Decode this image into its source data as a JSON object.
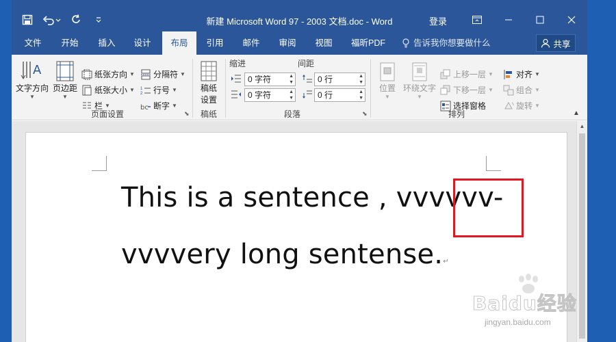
{
  "window": {
    "title": "新建 Microsoft Word 97 - 2003 文档.doc  -  Word",
    "login": "登录"
  },
  "tabs": [
    {
      "label": "文件"
    },
    {
      "label": "开始"
    },
    {
      "label": "插入"
    },
    {
      "label": "设计"
    },
    {
      "label": "布局",
      "active": true
    },
    {
      "label": "引用"
    },
    {
      "label": "邮件"
    },
    {
      "label": "审阅"
    },
    {
      "label": "视图"
    },
    {
      "label": "福昕PDF"
    }
  ],
  "tell_me": "告诉我你想要做什么",
  "share": "共享",
  "ribbon": {
    "page_setup": {
      "text_direction": "文字方向",
      "margins": "页边距",
      "orientation": "纸张方向",
      "size": "纸张大小",
      "columns": "栏",
      "breaks": "分隔符",
      "line_numbers": "行号",
      "hyphenation": "断字",
      "label": "页面设置"
    },
    "draft": {
      "button": "稿纸设置",
      "button_line1": "稿纸",
      "button_line2": "设置",
      "label": "稿纸"
    },
    "paragraph": {
      "indent_label": "缩进",
      "spacing_label": "间距",
      "indent_left": "0 字符",
      "indent_right": "0 字符",
      "spacing_before": "0 行",
      "spacing_after": "0 行",
      "label": "段落"
    },
    "arrange": {
      "position": "位置",
      "wrap_text": "环绕文字",
      "bring_forward": "上移一层",
      "send_backward": "下移一层",
      "selection_pane": "选择窗格",
      "align": "对齐",
      "group": "组合",
      "rotate": "旋转",
      "label": "排列"
    }
  },
  "document": {
    "line1": "This is a sentence , vvvvvv-",
    "line2": "vvvvery long sentense.",
    "para_mark": "↵"
  },
  "watermark": {
    "brand": "Baidu经验",
    "url": "jingyan.baidu.com"
  },
  "colors": {
    "title_bar": "#2b579a",
    "highlight_box": "#e8141e"
  }
}
